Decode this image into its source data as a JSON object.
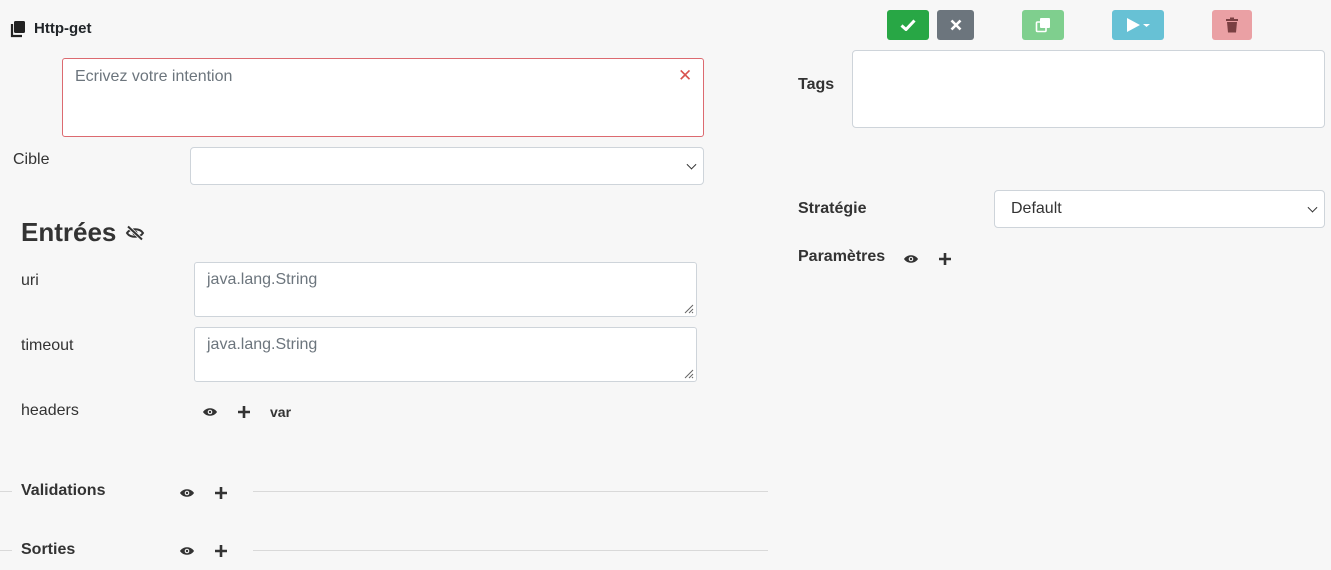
{
  "header": {
    "title": "Http-get"
  },
  "toolbar": {
    "save_icon": "check-icon",
    "cancel_icon": "close-icon",
    "copy_icon": "copy-icon",
    "run_icon": "play-dropdown-icon",
    "delete_icon": "trash-icon",
    "colors": {
      "save": "#28a745",
      "cancel": "#6c757d",
      "copy": "#7fcf8e",
      "run": "#67c1d5",
      "delete": "#eaa0a4"
    }
  },
  "intention": {
    "placeholder": "Ecrivez votre intention"
  },
  "cible": {
    "label": "Cible",
    "value": ""
  },
  "entrees": {
    "title": "Entrées",
    "fields": [
      {
        "label": "uri",
        "placeholder": "java.lang.String"
      },
      {
        "label": "timeout",
        "placeholder": "java.lang.String"
      },
      {
        "label": "headers",
        "var_label": "var"
      }
    ]
  },
  "validations": {
    "label": "Validations"
  },
  "sorties": {
    "label": "Sorties"
  },
  "tags": {
    "label": "Tags"
  },
  "strategie": {
    "label": "Stratégie",
    "value": "Default"
  },
  "parametres": {
    "label": "Paramètres"
  }
}
